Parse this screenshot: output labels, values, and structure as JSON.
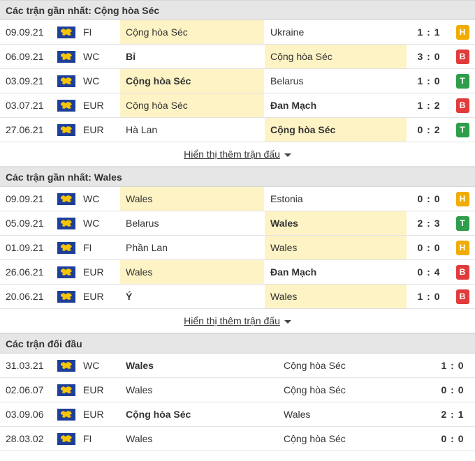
{
  "colors": {
    "draw": "#f0ad00",
    "loss": "#e23b3b",
    "win": "#2e9e4a",
    "highlight": "#fdf3c4",
    "flag_blue": "#1e3f99",
    "flag_gold": "#f6c400"
  },
  "icons": {
    "competition_flag": "world-flag-icon",
    "expand": "caret-down-icon"
  },
  "section1": {
    "title": "Các trận gần nhất: Cộng hòa Séc",
    "rows": [
      {
        "date": "09.09.21",
        "comp": "FI",
        "home": "Cộng hòa Séc",
        "away": "Ukraine",
        "score": "1 : 1",
        "result": "H"
      },
      {
        "date": "06.09.21",
        "comp": "WC",
        "home": "Bỉ",
        "away": "Cộng hòa Séc",
        "score": "3 : 0",
        "result": "B"
      },
      {
        "date": "03.09.21",
        "comp": "WC",
        "home": "Cộng hòa Séc",
        "away": "Belarus",
        "score": "1 : 0",
        "result": "T"
      },
      {
        "date": "03.07.21",
        "comp": "EUR",
        "home": "Cộng hòa Séc",
        "away": "Đan Mạch",
        "score": "1 : 2",
        "result": "B"
      },
      {
        "date": "27.06.21",
        "comp": "EUR",
        "home": "Hà Lan",
        "away": "Cộng hòa Séc",
        "score": "0 : 2",
        "result": "T"
      }
    ],
    "more_label": "Hiển thị thêm trận đấu"
  },
  "section2": {
    "title": "Các trận gần nhất: Wales",
    "rows": [
      {
        "date": "09.09.21",
        "comp": "WC",
        "home": "Wales",
        "away": "Estonia",
        "score": "0 : 0",
        "result": "H"
      },
      {
        "date": "05.09.21",
        "comp": "WC",
        "home": "Belarus",
        "away": "Wales",
        "score": "2 : 3",
        "result": "T"
      },
      {
        "date": "01.09.21",
        "comp": "FI",
        "home": "Phần Lan",
        "away": "Wales",
        "score": "0 : 0",
        "result": "H"
      },
      {
        "date": "26.06.21",
        "comp": "EUR",
        "home": "Wales",
        "away": "Đan Mạch",
        "score": "0 : 4",
        "result": "B"
      },
      {
        "date": "20.06.21",
        "comp": "EUR",
        "home": "Ý",
        "away": "Wales",
        "score": "1 : 0",
        "result": "B"
      }
    ],
    "more_label": "Hiển thị thêm trận đấu"
  },
  "section3": {
    "title": "Các trận đối đầu",
    "rows": [
      {
        "date": "31.03.21",
        "comp": "WC",
        "home": "Wales",
        "away": "Cộng hòa Séc",
        "score": "1 : 0"
      },
      {
        "date": "02.06.07",
        "comp": "EUR",
        "home": "Wales",
        "away": "Cộng hòa Séc",
        "score": "0 : 0"
      },
      {
        "date": "03.09.06",
        "comp": "EUR",
        "home": "Cộng hòa Séc",
        "away": "Wales",
        "score": "2 : 1"
      },
      {
        "date": "28.03.02",
        "comp": "FI",
        "home": "Wales",
        "away": "Cộng hòa Séc",
        "score": "0 : 0"
      }
    ]
  }
}
